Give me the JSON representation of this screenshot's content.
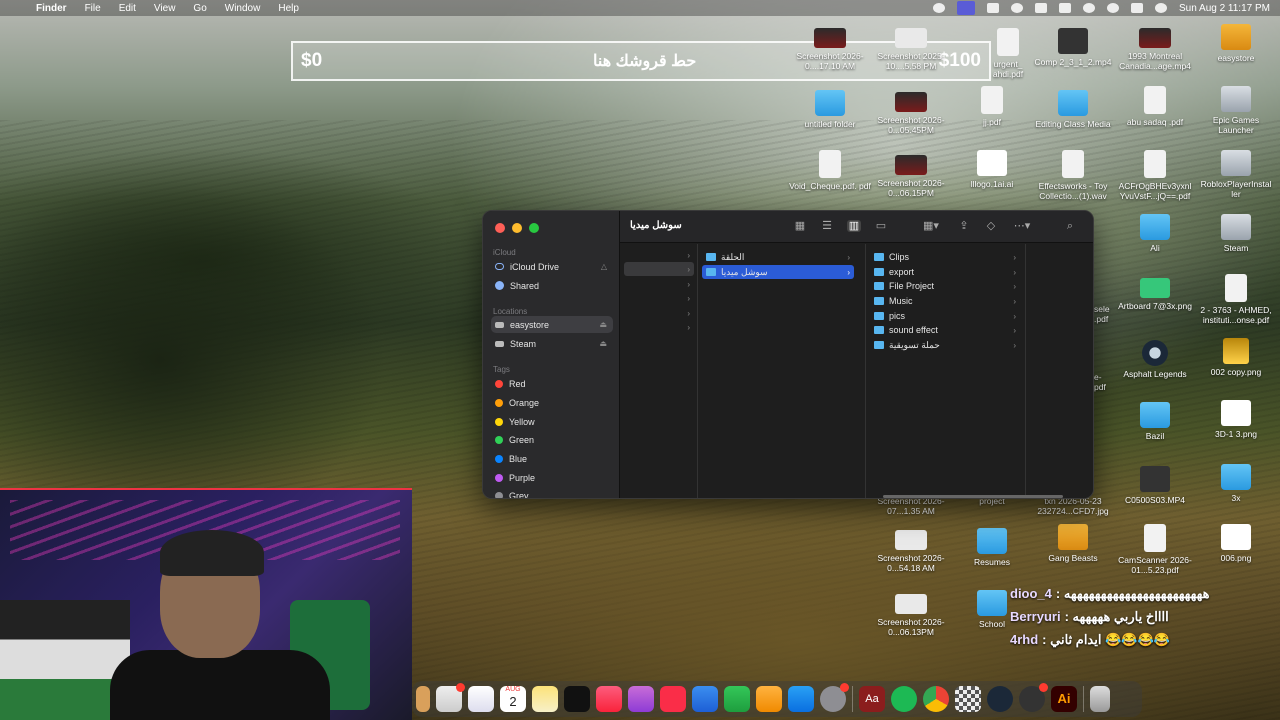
{
  "menubar": {
    "app": "Finder",
    "items": [
      "File",
      "Edit",
      "View",
      "Go",
      "Window",
      "Help"
    ],
    "clock": "Sun Aug 2  11:17 PM"
  },
  "donation": {
    "min": "$0",
    "text": "حط قروشك هنا",
    "max": "$100"
  },
  "desktop_icons": [
    {
      "label": "Screenshot 2026-0....17.10 AM",
      "icon": "screenshot-icon"
    },
    {
      "label": "Screenshot 2025-10....5.58 PM",
      "icon": "screenshot-icon"
    },
    {
      "label": "urgent_ ahdi.pdf",
      "icon": "pdf-icon"
    },
    {
      "label": "Comp 2_3_1_2.mp4",
      "icon": "video-icon"
    },
    {
      "label": "1993 Montreal Canadia...age.mp4",
      "icon": "video-icon"
    },
    {
      "label": "easystore",
      "icon": "drive-icon"
    },
    {
      "label": "untitled folder",
      "icon": "folder-icon"
    },
    {
      "label": "Screenshot 2026-0...05.45PM",
      "icon": "screenshot-icon"
    },
    {
      "label": "jj.pdf",
      "icon": "pdf-icon"
    },
    {
      "label": "Editing Class Media",
      "icon": "folder-icon"
    },
    {
      "label": "abu sadaq .pdf",
      "icon": "pdf-icon"
    },
    {
      "label": "Epic Games Launcher",
      "icon": "app-icon"
    },
    {
      "label": "Void_Cheque.pdf. pdf",
      "icon": "pdf-icon"
    },
    {
      "label": "Screenshot 2026-0...06.15PM",
      "icon": "screenshot-icon"
    },
    {
      "label": "lllogo.1ai.ai",
      "icon": "ai-file-icon"
    },
    {
      "label": "Effectsworks - Toy Collectio...(1).wav",
      "icon": "audio-icon"
    },
    {
      "label": "ACFrOgBHEv3yxnl YvuVstF...jQ==.pdf",
      "icon": "pdf-icon"
    },
    {
      "label": "RobloxPlayerInstal ler",
      "icon": "app-icon"
    },
    {
      "label": "Ali",
      "icon": "folder-icon"
    },
    {
      "label": "Steam",
      "icon": "app-icon"
    },
    {
      "label": "Artboard 7@3x.png",
      "icon": "image-icon"
    },
    {
      "label": "2 - 3763 - AHMED, instituti...onse.pdf",
      "icon": "pdf-icon"
    },
    {
      "label": "Asphalt Legends",
      "icon": "steam-icon"
    },
    {
      "label": "002 copy.png",
      "icon": "image-icon"
    },
    {
      "label": "Bazil",
      "icon": "folder-icon"
    },
    {
      "label": "3D-1 3.png",
      "icon": "image-icon"
    },
    {
      "label": "C0500S03.MP4",
      "icon": "video-icon"
    },
    {
      "label": "3x",
      "icon": "folder-icon"
    },
    {
      "label": "Screenshot 2026-07...1.35 AM",
      "icon": "screenshot-icon"
    },
    {
      "label": "project",
      "icon": "folder-icon"
    },
    {
      "label": "txn 2026-05-23 232724...CFD7.jpg",
      "icon": "image-icon"
    },
    {
      "label": "Screenshot 2026-0...54.18 AM",
      "icon": "screenshot-icon"
    },
    {
      "label": "Resumes",
      "icon": "folder-icon"
    },
    {
      "label": "Gang Beasts",
      "icon": "app-icon"
    },
    {
      "label": "CamScanner 2026-01...5.23.pdf",
      "icon": "pdf-icon"
    },
    {
      "label": "006.png",
      "icon": "image-icon"
    },
    {
      "label": "Screenshot 2026-0...06.13PM",
      "icon": "screenshot-icon"
    },
    {
      "label": "School",
      "icon": "folder-icon"
    },
    {
      "label": "sele .pdf",
      "icon": "pdf-icon"
    },
    {
      "label": "e- pdf",
      "icon": "pdf-icon"
    }
  ],
  "finder": {
    "title": "سوشل ميديا",
    "sidebar": {
      "icloud_header": "iCloud",
      "icloud": [
        "iCloud Drive",
        "Shared"
      ],
      "locations_header": "Locations",
      "locations": [
        "easystore",
        "Steam"
      ],
      "tags_header": "Tags",
      "tags": [
        {
          "name": "Red",
          "color": "#ff453a"
        },
        {
          "name": "Orange",
          "color": "#ff9f0a"
        },
        {
          "name": "Yellow",
          "color": "#ffd60a"
        },
        {
          "name": "Green",
          "color": "#30d158"
        },
        {
          "name": "Blue",
          "color": "#0a84ff"
        },
        {
          "name": "Purple",
          "color": "#bf5af2"
        },
        {
          "name": "Grey",
          "color": "#8e8e93"
        }
      ]
    },
    "col2": [
      "الحلقة",
      "سوشل ميديا"
    ],
    "col3": [
      "Clips",
      "export",
      "File Project",
      "Music",
      "pics",
      "sound effect",
      "حملة تسويقية"
    ]
  },
  "chat": [
    {
      "user": "dioo_4",
      "text": ": هههههههههههههههههههههههه"
    },
    {
      "user": "Berryuri",
      "text": ": ااااخ ياربي هههههه"
    },
    {
      "user": "4rhd",
      "text": ": ايدام ثاني 😂😂😂😂"
    }
  ],
  "dock": {
    "apps": [
      "launchpad",
      "messages",
      "freeform",
      "calendar",
      "notes",
      "tv",
      "music",
      "podcasts",
      "news",
      "keynote",
      "numbers",
      "pages",
      "app-store",
      "system-settings",
      "dictionary",
      "spotify",
      "chrome",
      "checker",
      "steam",
      "activity",
      "illustrator"
    ],
    "calendar_day": "2",
    "calendar_month": "AUG",
    "dictionary_label": "Aa",
    "illustrator_label": "Ai"
  }
}
